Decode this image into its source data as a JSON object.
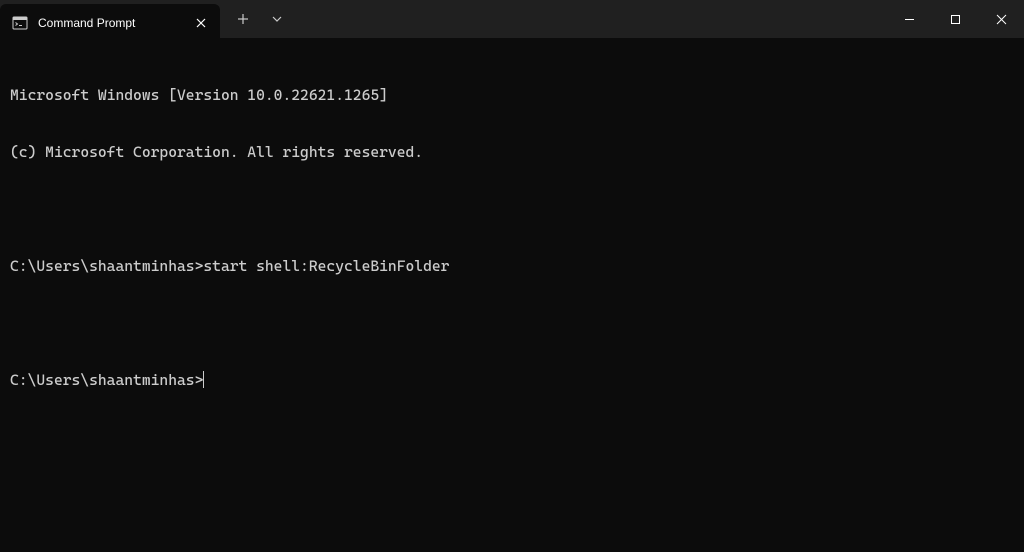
{
  "titlebar": {
    "tab_title": "Command Prompt"
  },
  "terminal": {
    "lines": [
      "Microsoft Windows [Version 10.0.22621.1265]",
      "(c) Microsoft Corporation. All rights reserved.",
      "",
      "C:\\Users\\shaantminhas>start shell:RecycleBinFolder",
      "",
      "C:\\Users\\shaantminhas>"
    ],
    "banner_line1": "Microsoft Windows [Version 10.0.22621.1265]",
    "banner_line2": "(c) Microsoft Corporation. All rights reserved.",
    "prompt1": "C:\\Users\\shaantminhas>",
    "command1": "start shell:RecycleBinFolder",
    "prompt2": "C:\\Users\\shaantminhas>"
  }
}
